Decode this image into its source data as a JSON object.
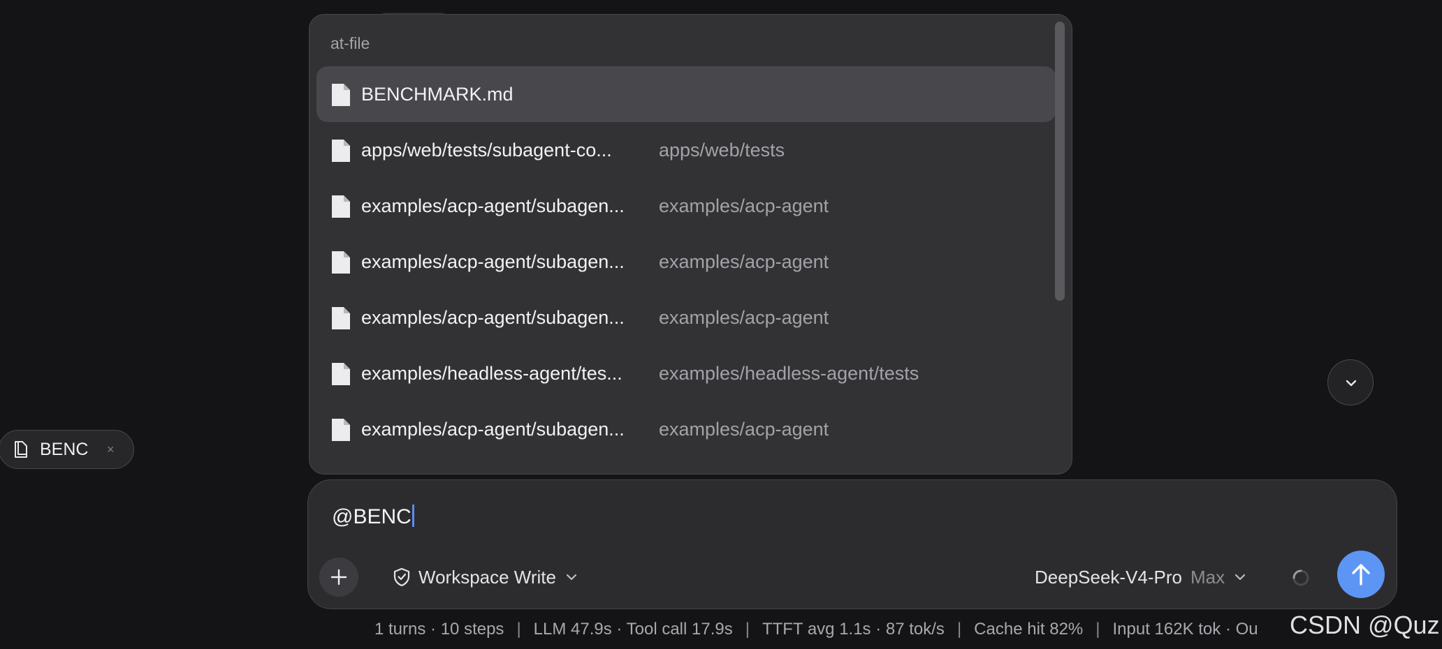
{
  "popup": {
    "title": "at-file",
    "items": [
      {
        "name": "BENCHMARK.md",
        "path": "",
        "selected": true
      },
      {
        "name": "apps/web/tests/subagent-co...",
        "path": "apps/web/tests"
      },
      {
        "name": "examples/acp-agent/subagen...",
        "path": "examples/acp-agent"
      },
      {
        "name": "examples/acp-agent/subagen...",
        "path": "examples/acp-agent"
      },
      {
        "name": "examples/acp-agent/subagen...",
        "path": "examples/acp-agent"
      },
      {
        "name": "examples/headless-agent/tes...",
        "path": "examples/headless-agent/tests"
      },
      {
        "name": "examples/acp-agent/subagen...",
        "path": "examples/acp-agent"
      }
    ]
  },
  "chip": {
    "label": "BENC",
    "close": "×"
  },
  "composer": {
    "input_value": "@BENC",
    "mode_label": "Workspace Write",
    "model_name": "DeepSeek-V4-Pro",
    "model_effort": "Max"
  },
  "status": {
    "turns": "1 turns · 10 steps",
    "llm": "LLM 47.9s · Tool call 17.9s",
    "ttft": "TTFT avg 1.1s · 87 tok/s",
    "cache": "Cache hit 82%",
    "input": "Input 162K tok · Ou",
    "sep": "|"
  },
  "watermark": "CSDN @Quz",
  "colors": {
    "accent": "#5c95f4",
    "caret": "#5b8cf0"
  }
}
